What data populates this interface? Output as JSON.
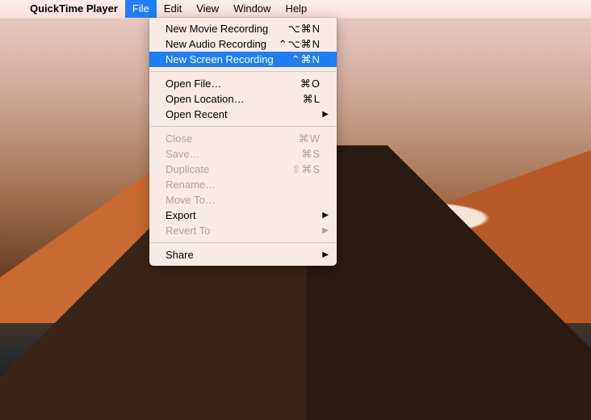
{
  "menubar": {
    "app_name": "QuickTime Player",
    "items": [
      {
        "label": "File",
        "open": true
      },
      {
        "label": "Edit",
        "open": false
      },
      {
        "label": "View",
        "open": false
      },
      {
        "label": "Window",
        "open": false
      },
      {
        "label": "Help",
        "open": false
      }
    ]
  },
  "file_menu": {
    "groups": [
      [
        {
          "label": "New Movie Recording",
          "shortcut": "⌥⌘N",
          "enabled": true,
          "submenu": false,
          "highlight": false
        },
        {
          "label": "New Audio Recording",
          "shortcut": "⌃⌥⌘N",
          "enabled": true,
          "submenu": false,
          "highlight": false
        },
        {
          "label": "New Screen Recording",
          "shortcut": "⌃⌘N",
          "enabled": true,
          "submenu": false,
          "highlight": true
        }
      ],
      [
        {
          "label": "Open File…",
          "shortcut": "⌘O",
          "enabled": true,
          "submenu": false,
          "highlight": false
        },
        {
          "label": "Open Location…",
          "shortcut": "⌘L",
          "enabled": true,
          "submenu": false,
          "highlight": false
        },
        {
          "label": "Open Recent",
          "shortcut": "",
          "enabled": true,
          "submenu": true,
          "highlight": false
        }
      ],
      [
        {
          "label": "Close",
          "shortcut": "⌘W",
          "enabled": false,
          "submenu": false,
          "highlight": false
        },
        {
          "label": "Save…",
          "shortcut": "⌘S",
          "enabled": false,
          "submenu": false,
          "highlight": false
        },
        {
          "label": "Duplicate",
          "shortcut": "⇧⌘S",
          "enabled": false,
          "submenu": false,
          "highlight": false
        },
        {
          "label": "Rename…",
          "shortcut": "",
          "enabled": false,
          "submenu": false,
          "highlight": false
        },
        {
          "label": "Move To…",
          "shortcut": "",
          "enabled": false,
          "submenu": false,
          "highlight": false
        },
        {
          "label": "Export",
          "shortcut": "",
          "enabled": true,
          "submenu": true,
          "highlight": false
        },
        {
          "label": "Revert To",
          "shortcut": "",
          "enabled": false,
          "submenu": true,
          "highlight": false
        }
      ],
      [
        {
          "label": "Share",
          "shortcut": "",
          "enabled": true,
          "submenu": true,
          "highlight": false
        }
      ]
    ]
  }
}
